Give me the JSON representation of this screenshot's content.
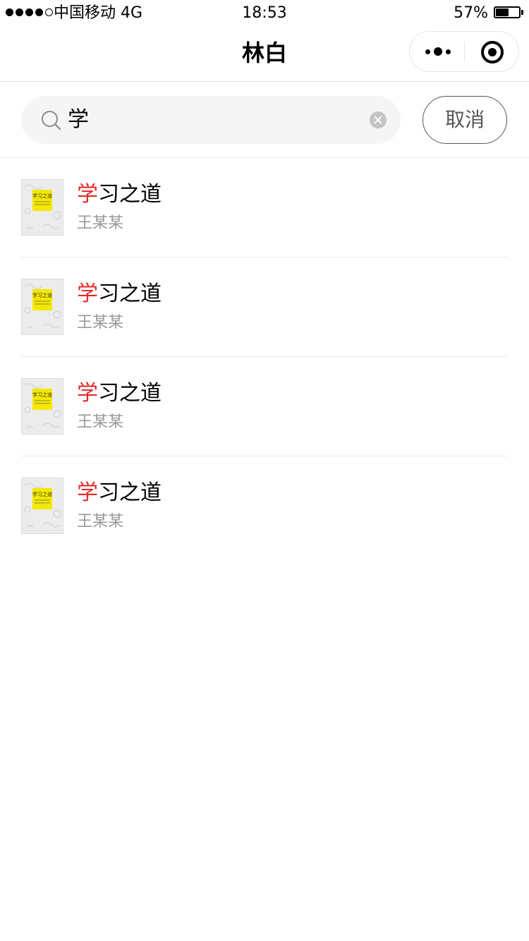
{
  "status_bar": {
    "carrier": "中国移动",
    "network": "4G",
    "time": "18:53",
    "battery": "57%",
    "battery_level": 0.57
  },
  "nav": {
    "title": "林白"
  },
  "search": {
    "query": "学",
    "cancel_label": "取消"
  },
  "results": [
    {
      "title_highlight": "学",
      "title_rest": "习之道",
      "author": "王某某",
      "cover_text": "学习之道"
    },
    {
      "title_highlight": "学",
      "title_rest": "习之道",
      "author": "王某某",
      "cover_text": "学习之道"
    },
    {
      "title_highlight": "学",
      "title_rest": "习之道",
      "author": "王某某",
      "cover_text": "学习之道"
    },
    {
      "title_highlight": "学",
      "title_rest": "习之道",
      "author": "王某某",
      "cover_text": "学习之道"
    }
  ],
  "colors": {
    "highlight": "#e42a2a",
    "author_text": "#999999",
    "cover_accent": "#f4e800"
  }
}
